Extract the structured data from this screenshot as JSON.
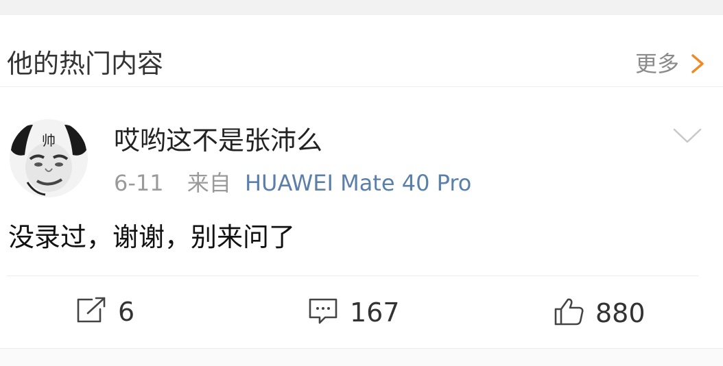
{
  "section": {
    "title": "他的热门内容",
    "more_label": "更多",
    "more_icon": "chevron-right-icon",
    "accent": "#f08a24"
  },
  "post": {
    "author": "哎哟这不是张沛么",
    "avatar_text": "帅",
    "date": "6-11",
    "source_prefix": "来自",
    "device": "HUAWEI Mate 40 Pro",
    "text": "没录过，谢谢，别来问了",
    "link_color": "#5a7fa8"
  },
  "actions": {
    "repost": {
      "icon": "repost-icon",
      "count": "6"
    },
    "comment": {
      "icon": "comment-icon",
      "count": "167"
    },
    "like": {
      "icon": "thumbs-up-icon",
      "count": "880"
    }
  }
}
